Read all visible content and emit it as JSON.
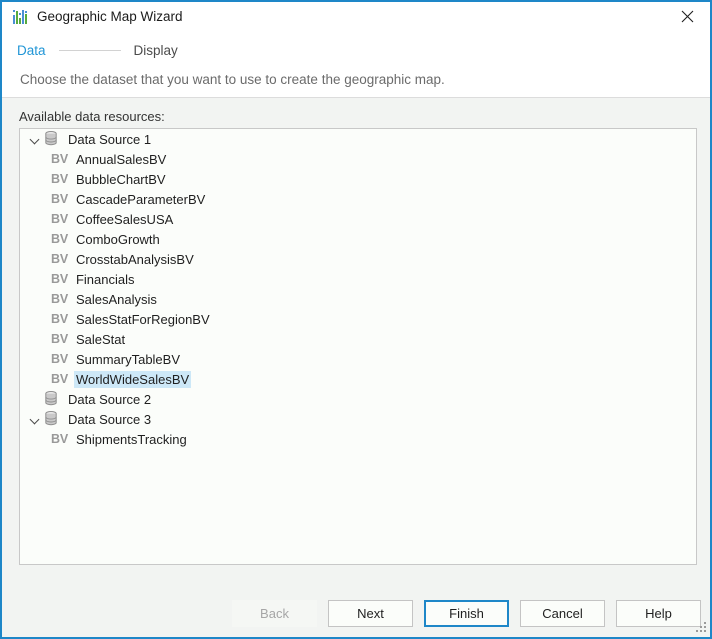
{
  "window": {
    "title": "Geographic Map Wizard",
    "app_icon": "bar-chart-icon",
    "close_icon": "close-icon",
    "accent_color": "#1e87c8",
    "background_color": "#f2f4f2"
  },
  "header": {
    "steps": [
      {
        "label": "Data",
        "state": "active"
      },
      {
        "label": "Display",
        "state": "inactive"
      }
    ],
    "description": "Choose the dataset that you want to use to create the geographic map."
  },
  "main": {
    "list_label": "Available data resources:",
    "selection_color": "#cde8f7",
    "tree": [
      {
        "label": "Data Source 1",
        "level": 0,
        "icon": "database-icon",
        "expanded": true,
        "selected": false
      },
      {
        "label": "AnnualSalesBV",
        "level": 1,
        "icon": "bv-icon",
        "selected": false
      },
      {
        "label": "BubbleChartBV",
        "level": 1,
        "icon": "bv-icon",
        "selected": false
      },
      {
        "label": "CascadeParameterBV",
        "level": 1,
        "icon": "bv-icon",
        "selected": false
      },
      {
        "label": "CoffeeSalesUSA",
        "level": 1,
        "icon": "bv-icon",
        "selected": false
      },
      {
        "label": "ComboGrowth",
        "level": 1,
        "icon": "bv-icon",
        "selected": false
      },
      {
        "label": "CrosstabAnalysisBV",
        "level": 1,
        "icon": "bv-icon",
        "selected": false
      },
      {
        "label": "Financials",
        "level": 1,
        "icon": "bv-icon",
        "selected": false
      },
      {
        "label": "SalesAnalysis",
        "level": 1,
        "icon": "bv-icon",
        "selected": false
      },
      {
        "label": "SalesStatForRegionBV",
        "level": 1,
        "icon": "bv-icon",
        "selected": false
      },
      {
        "label": "SaleStat",
        "level": 1,
        "icon": "bv-icon",
        "selected": false
      },
      {
        "label": "SummaryTableBV",
        "level": 1,
        "icon": "bv-icon",
        "selected": false
      },
      {
        "label": "WorldWideSalesBV",
        "level": 1,
        "icon": "bv-icon",
        "selected": true
      },
      {
        "label": "Data Source 2",
        "level": 0,
        "icon": "database-icon",
        "expanded": false,
        "selected": false
      },
      {
        "label": "Data Source 3",
        "level": 0,
        "icon": "database-icon",
        "expanded": true,
        "selected": false
      },
      {
        "label": "ShipmentsTracking",
        "level": 1,
        "icon": "bv-icon",
        "selected": false
      }
    ]
  },
  "footer": {
    "buttons": [
      {
        "label": "Back",
        "state": "disabled"
      },
      {
        "label": "Next",
        "state": "normal"
      },
      {
        "label": "Finish",
        "state": "default"
      },
      {
        "label": "Cancel",
        "state": "normal"
      },
      {
        "label": "Help",
        "state": "normal"
      }
    ]
  }
}
